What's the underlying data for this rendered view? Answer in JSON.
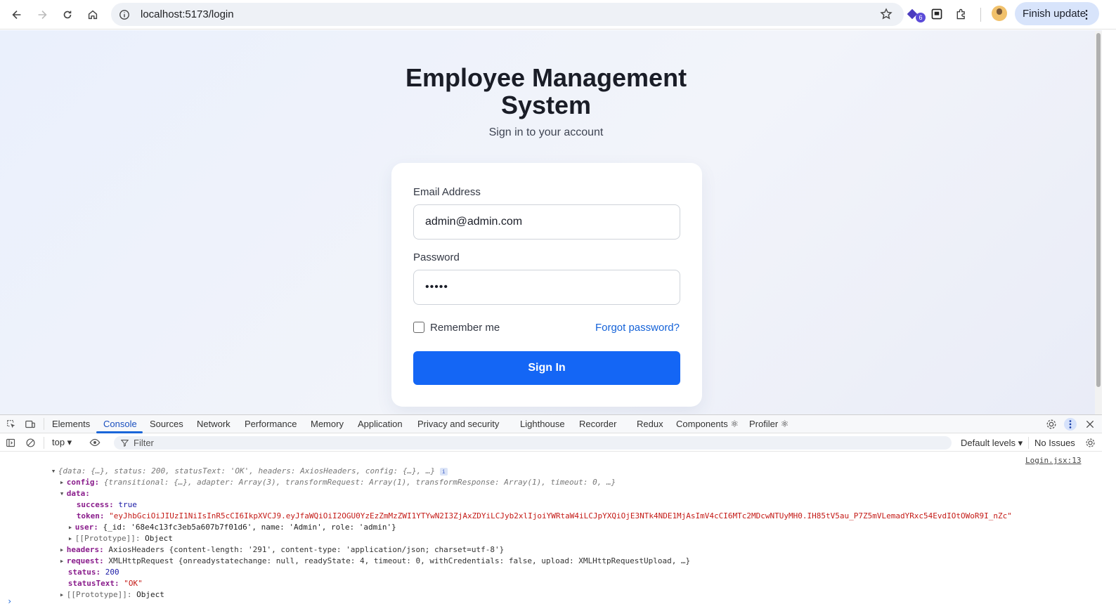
{
  "browser": {
    "url": "localhost:5173/login",
    "finish_update": "Finish update",
    "extension_badge": "6"
  },
  "page": {
    "title": "Employee Management System",
    "subtitle": "Sign in to your account",
    "form": {
      "email_label": "Email Address",
      "email_value": "admin@admin.com",
      "password_label": "Password",
      "password_value": "•••••",
      "remember_label": "Remember me",
      "remember_checked": false,
      "forgot_label": "Forgot password?",
      "signin_label": "Sign In"
    }
  },
  "devtools": {
    "tabs": [
      "Elements",
      "Console",
      "Sources",
      "Network",
      "Performance",
      "Memory",
      "Application",
      "Privacy and security",
      "Lighthouse",
      "Recorder",
      "Redux",
      "Components ⚛",
      "Profiler ⚛"
    ],
    "active_tab": "Console",
    "context": "top ▾",
    "filter_placeholder": "Filter",
    "levels": "Default levels ▾",
    "issues": "No Issues",
    "source_link": "Login.jsx:13",
    "log": {
      "summary": "{data: {…}, status: 200, statusText: 'OK', headers: AxiosHeaders, config: {…}, …}",
      "config": "{transitional: {…}, adapter: Array(3), transformRequest: Array(1), transformResponse: Array(1), timeout: 0, …}",
      "success": "true",
      "token": "\"eyJhbGciOiJIUzI1NiIsInR5cCI6IkpXVCJ9.eyJfaWQiOiI2OGU0YzEzZmMzZWI1YTYwN2I3ZjAxZDYiLCJyb2xlIjoiYWRtaW4iLCJpYXQiOjE3NTk4NDE1MjAsImV4cCI6MTc2MDcwNTUyMH0.IH85tV5au_P7Z5mVLemadYRxc54EvdIOtOWoR9I_nZc\"",
      "user": "{_id: '68e4c13fc3eb5a607b7f01d6', name: 'Admin', role: 'admin'}",
      "proto_object": "Object",
      "headers": "AxiosHeaders {content-length: '291', content-type: 'application/json; charset=utf-8'}",
      "request": "XMLHttpRequest {onreadystatechange: null, readyState: 4, timeout: 0, withCredentials: false, upload: XMLHttpRequestUpload, …}",
      "status": "200",
      "statusText": "\"OK\""
    }
  }
}
